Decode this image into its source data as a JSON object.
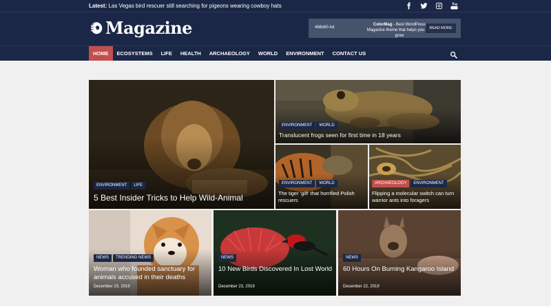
{
  "topbar": {
    "latest_label": "Latest:",
    "latest_text": "Las Vegas bird rescuer still searching for pigeons wearing cowboy hats",
    "social": [
      "facebook-icon",
      "twitter-icon",
      "instagram-icon",
      "youtube-icon"
    ]
  },
  "logo": {
    "text": "Magazine"
  },
  "ad": {
    "size": "468x60 Ad",
    "brand": "ColorMag",
    "copy": " - Best WordPress Magazine theme that helps you site grow",
    "button": "READ MORE"
  },
  "nav": {
    "items": [
      "HOME",
      "ECOSYSTEMS",
      "LIFE",
      "HEALTH",
      "ARCHAEOLOGY",
      "WORLD",
      "ENVIRONMENT",
      "CONTACT US"
    ],
    "active": "HOME"
  },
  "posts": {
    "lion": {
      "cats": [
        "ENVIRONMENT",
        "LIFE"
      ],
      "title": "5 Best Insider Tricks to Help Wild-Animal"
    },
    "frog": {
      "cats": [
        "ENVIRONMENT",
        "WORLD"
      ],
      "title": "Translucent frogs seen for first time in 18 years"
    },
    "tiger": {
      "cats": [
        "ENVIRONMENT",
        "WORLD"
      ],
      "title": "The tiger 'gift' that horrified Polish rescuers"
    },
    "ants": {
      "cats": [
        "ARCHAEOLOGY",
        "ENVIRONMENT"
      ],
      "title": "Flipping a molecular switch can turn warrior ants into foragers"
    },
    "dog": {
      "cats": [
        "NEWS",
        "TRENDING NEWS"
      ],
      "title": "Woman who founded sanctuary for animals accused in their deaths",
      "date": "December 23, 2019"
    },
    "bird": {
      "cats": [
        "NEWS"
      ],
      "title": "10 New Birds Discovered In Lost World",
      "date": "December 23, 2019"
    },
    "kangaroo": {
      "cats": [
        "NEWS"
      ],
      "title": "60 Hours On Burning Kangaroo Island",
      "date": "December 22, 2019"
    }
  },
  "colors": {
    "header": "#1b2746",
    "accent": "#c0504d",
    "background": "#f0f0f0"
  }
}
